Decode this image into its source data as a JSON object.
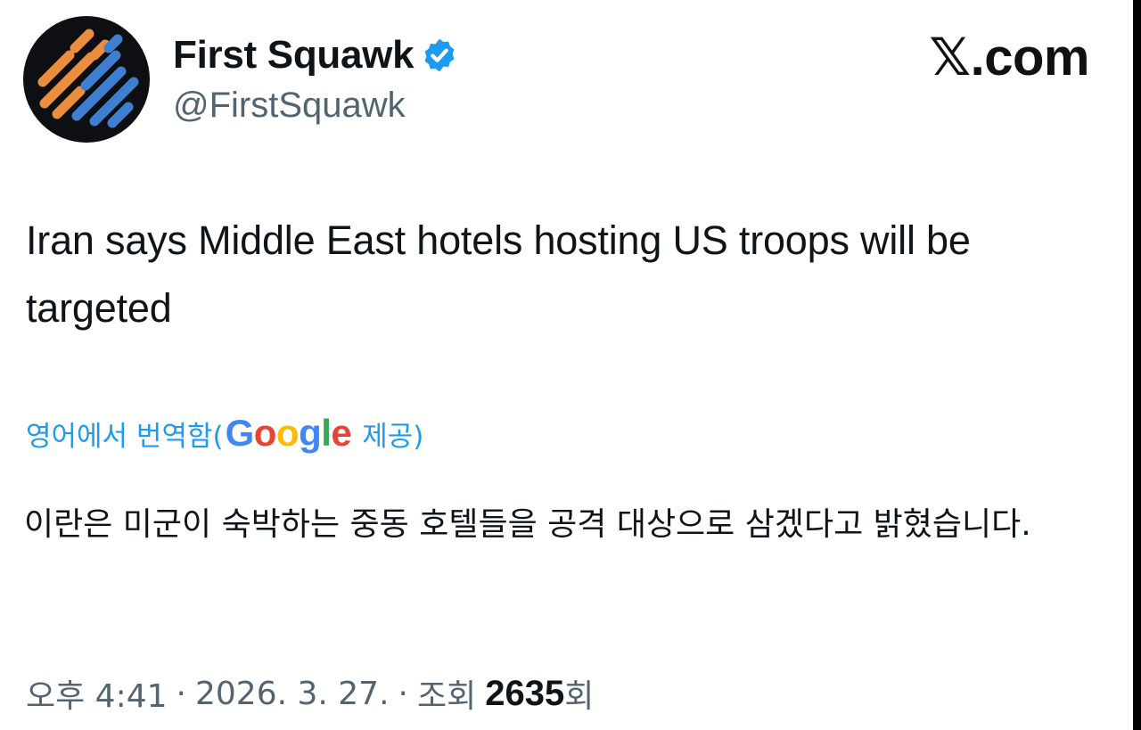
{
  "author": {
    "display_name": "First Squawk",
    "handle": "@FirstSquawk",
    "verified": true,
    "avatar_icon": "first-squawk-logo-icon",
    "verified_icon": "verified-badge-icon"
  },
  "brand": {
    "label": "𝕏.com"
  },
  "tweet": {
    "text": "Iran says Middle East hotels hosting US troops will be targeted"
  },
  "translation": {
    "prefix": "영어에서 번역함(",
    "provider_letters": [
      "G",
      "o",
      "o",
      "g",
      "l",
      "e"
    ],
    "suffix": "제공)",
    "text": "이란은 미군이 숙박하는 중동 호텔들을 공격 대상으로 삼겠다고 밝혔습니다."
  },
  "meta": {
    "time": "오후 4:41",
    "separator": "·",
    "date": "2026. 3. 27.",
    "views_label": "조회",
    "views_count": "2635",
    "views_suffix": "회"
  },
  "colors": {
    "link_blue": "#1d9bf0",
    "secondary_gray": "#536471",
    "avatar_orange": "#e98d3f",
    "avatar_blue": "#3f7fd0",
    "google_blue": "#4285f4",
    "google_red": "#ea4335",
    "google_yellow": "#fbbc05",
    "google_green": "#34a853"
  }
}
